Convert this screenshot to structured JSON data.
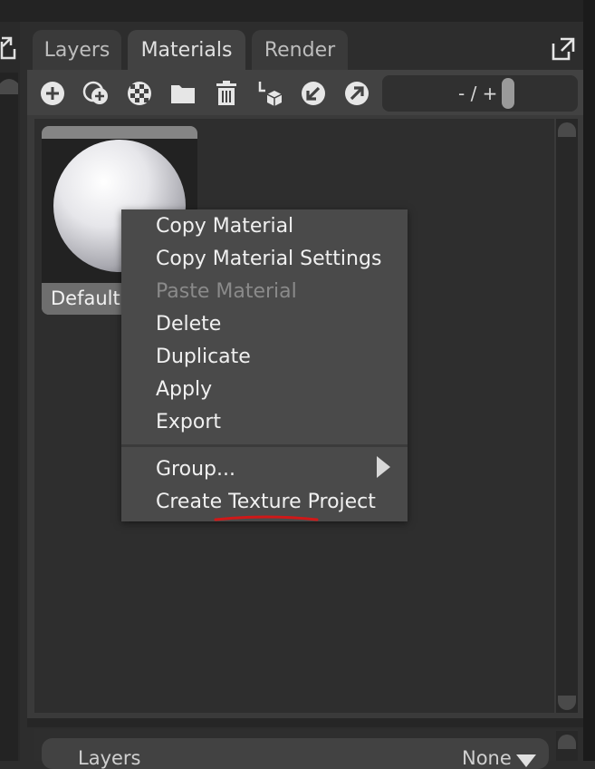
{
  "tabs": [
    {
      "label": "Layers",
      "active": false
    },
    {
      "label": "Materials",
      "active": true
    },
    {
      "label": "Render",
      "active": false
    }
  ],
  "toolbar": {
    "icons": [
      "add-icon",
      "add-layered-icon",
      "checker-icon",
      "folder-icon",
      "trash-icon",
      "shapes-icon",
      "import-icon",
      "export-icon"
    ],
    "zoom_label": "- / +"
  },
  "material": {
    "name": "Default"
  },
  "context_menu": {
    "items": [
      {
        "label": "Copy Material",
        "enabled": true
      },
      {
        "label": "Copy Material Settings",
        "enabled": true
      },
      {
        "label": "Paste Material",
        "enabled": false
      },
      {
        "label": "Delete",
        "enabled": true
      },
      {
        "label": "Duplicate",
        "enabled": true
      },
      {
        "label": "Apply",
        "enabled": true
      },
      {
        "label": "Export",
        "enabled": true
      }
    ],
    "items_after_separator": [
      {
        "label": "Group...",
        "has_submenu": true
      },
      {
        "label": "Create Texture Project",
        "has_submenu": false
      }
    ]
  },
  "bottom_panel": {
    "label": "Layers",
    "value": "None"
  },
  "colors": {
    "annotation_underline": "#d01818",
    "menu_background": "#4a4a4a",
    "disabled_text": "#8a8a8a"
  }
}
